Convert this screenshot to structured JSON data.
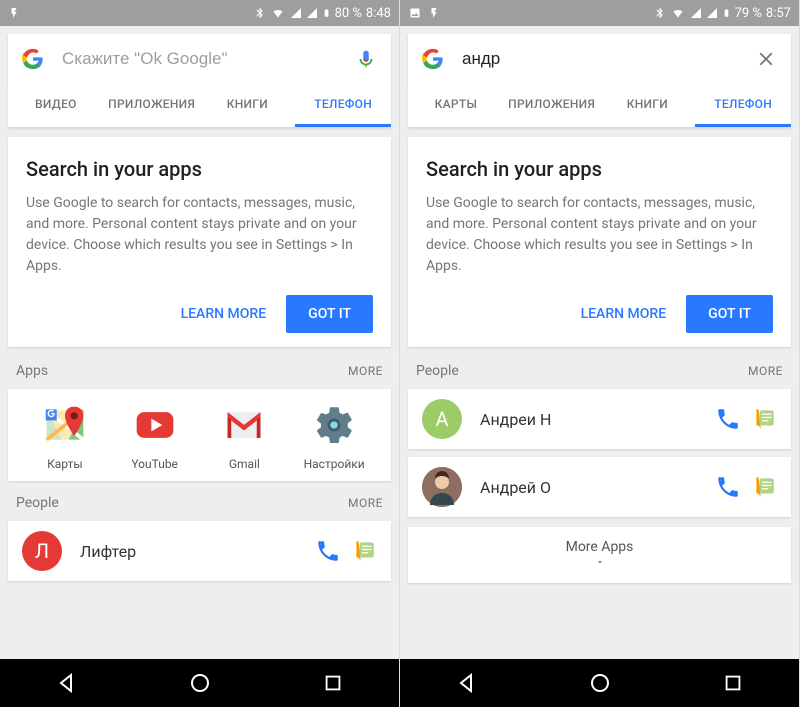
{
  "left": {
    "status": {
      "battery": "80 %",
      "time": "8:48"
    },
    "search": {
      "placeholder": "Скажите \"Ok Google\"",
      "value": ""
    },
    "tabs": [
      "ВИДЕО",
      "ПРИЛОЖЕНИЯ",
      "КНИГИ",
      "ТЕЛЕФОН"
    ],
    "active_tab": 3,
    "card": {
      "title": "Search in your apps",
      "body": "Use Google to search for contacts, messages, music, and more. Personal content stays private and on your device. Choose which results you see in Settings > In Apps.",
      "learn_label": "LEARN MORE",
      "gotit_label": "GOT IT"
    },
    "apps_header": "Apps",
    "more_label": "MORE",
    "apps": [
      {
        "label": "Карты",
        "icon": "maps"
      },
      {
        "label": "YouTube",
        "icon": "youtube"
      },
      {
        "label": "Gmail",
        "icon": "gmail"
      },
      {
        "label": "Настройки",
        "icon": "settings"
      }
    ],
    "people_header": "People",
    "people": [
      {
        "name": "Лифтер",
        "avatar_letter": "Л",
        "avatar_color": "#e53935"
      }
    ]
  },
  "right": {
    "status": {
      "battery": "79 %",
      "time": "8:57"
    },
    "search": {
      "placeholder": "",
      "value": "андр"
    },
    "tabs": [
      "КАРТЫ",
      "ПРИЛОЖЕНИЯ",
      "КНИГИ",
      "ТЕЛЕФОН"
    ],
    "active_tab": 3,
    "card": {
      "title": "Search in your apps",
      "body": "Use Google to search for contacts, messages, music, and more. Personal content stays private and on your device. Choose which results you see in Settings > In Apps.",
      "learn_label": "LEARN MORE",
      "gotit_label": "GOT IT"
    },
    "people_header": "People",
    "more_label": "MORE",
    "people": [
      {
        "name": "Андреи Н",
        "avatar_letter": "А",
        "avatar_color": "#9ccc65"
      },
      {
        "name": "Андрей О",
        "avatar_letter": "",
        "avatar_color": "#8d6e63"
      }
    ],
    "more_apps_label": "More Apps"
  }
}
